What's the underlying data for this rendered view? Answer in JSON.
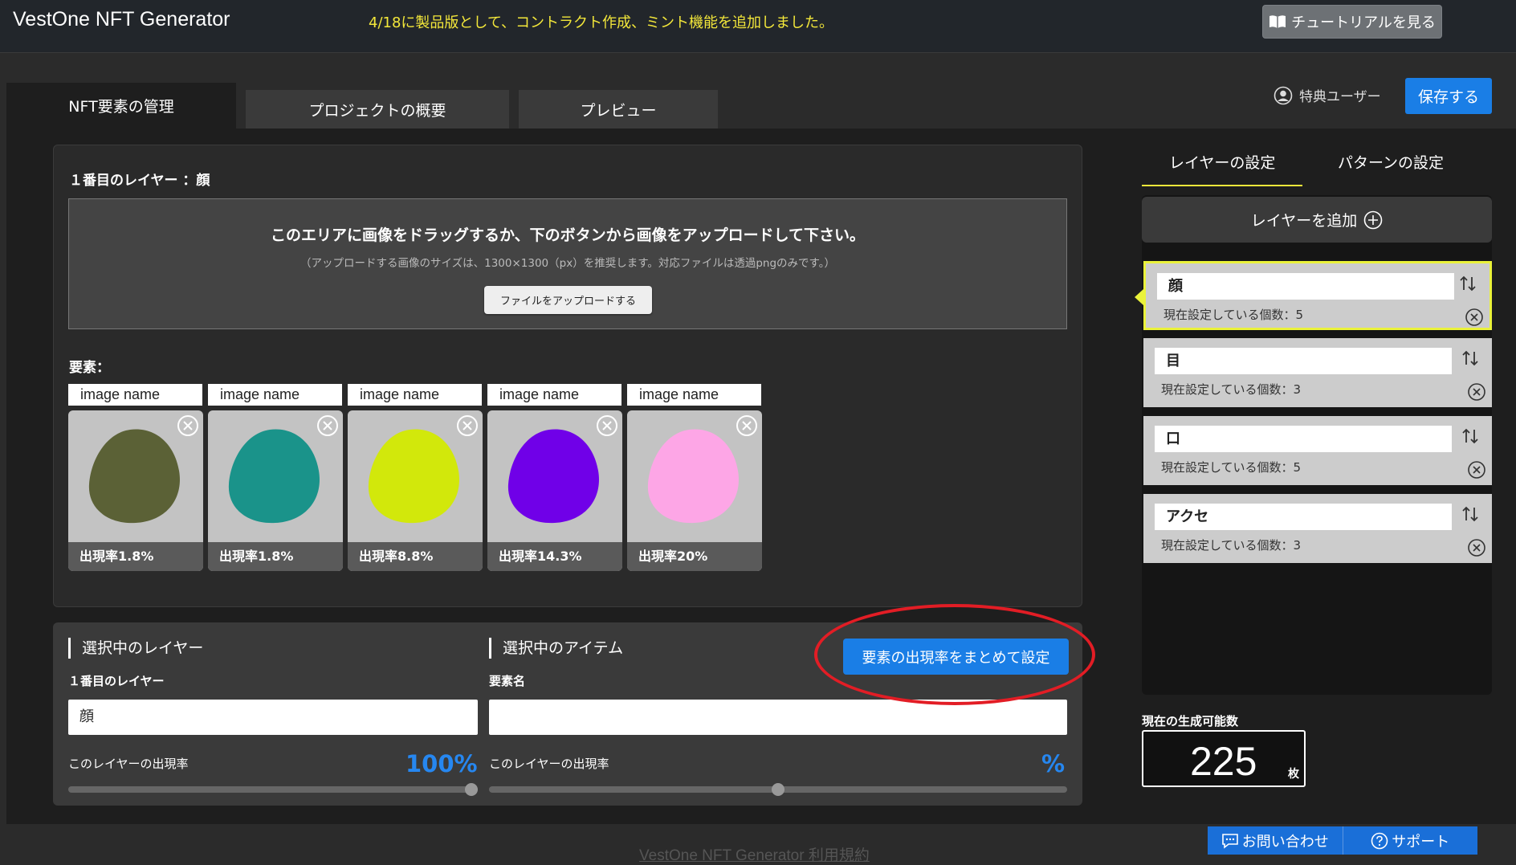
{
  "header": {
    "app_title": "VestOne NFT Generator",
    "announcement": "4/18に製品版として、コントラクト作成、ミント機能を追加しました。",
    "tutorial_label": "チュートリアルを見る"
  },
  "tabs": [
    {
      "label": "NFT要素の管理"
    },
    {
      "label": "プロジェクトの概要"
    },
    {
      "label": "プレビュー"
    }
  ],
  "user": {
    "label": "特典ユーザー"
  },
  "save_label": "保存する",
  "layer_panel": {
    "heading": "１番目のレイヤー ：顔",
    "dropzone_title": "このエリアに画像をドラッグするか、下のボタンから画像をアップロードして下さい。",
    "dropzone_sub": "（アップロードする画像のサイズは、1300×1300（px）を推奨します。対応ファイルは透過pngのみです。）",
    "upload_label": "ファイルをアップロードする",
    "elements_label": "要素："
  },
  "elements": [
    {
      "name": "image name",
      "rate": "出現率1.8%",
      "color": "#5b6136"
    },
    {
      "name": "image name",
      "rate": "出現率1.8%",
      "color": "#1a938a"
    },
    {
      "name": "image name",
      "rate": "出現率8.8%",
      "color": "#d2e80b"
    },
    {
      "name": "image name",
      "rate": "出現率14.3%",
      "color": "#7000e8"
    },
    {
      "name": "image name",
      "rate": "出現率20%",
      "color": "#fda6e6"
    }
  ],
  "bottom": {
    "selected_layer_title": "選択中のレイヤー",
    "selected_item_title": "選択中のアイテム",
    "layer_num_label": "１番目のレイヤー",
    "element_name_label": "要素名",
    "layer_value": "顔",
    "item_value": "",
    "layer_rate_label": "このレイヤーの出現率",
    "layer_rate_value": "100%",
    "layer_rate_fraction": 1.0,
    "item_rate_label": "このレイヤーの出現率",
    "item_rate_value": "%",
    "item_rate_fraction": 0.5,
    "bulk_label": "要素の出現率をまとめて設定"
  },
  "side": {
    "tab_layer": "レイヤーの設定",
    "tab_pattern": "パターンの設定",
    "add_layer_label": "レイヤーを追加",
    "layers": [
      {
        "name": "顔",
        "count": "現在設定している個数：5"
      },
      {
        "name": "目",
        "count": "現在設定している個数：3"
      },
      {
        "name": "口",
        "count": "現在設定している個数：5"
      },
      {
        "name": "アクセ",
        "count": "現在設定している個数：3"
      }
    ],
    "gen_label": "現在の生成可能数",
    "gen_value": "225",
    "gen_unit": "枚"
  },
  "footer": {
    "terms": "VestOne NFT Generator 利用規約",
    "contact": "お問い合わせ",
    "support": "サポート"
  },
  "colors": {
    "accent": "#1a7ee6",
    "highlight": "#eaf23a",
    "annotation": "#e21d25"
  }
}
